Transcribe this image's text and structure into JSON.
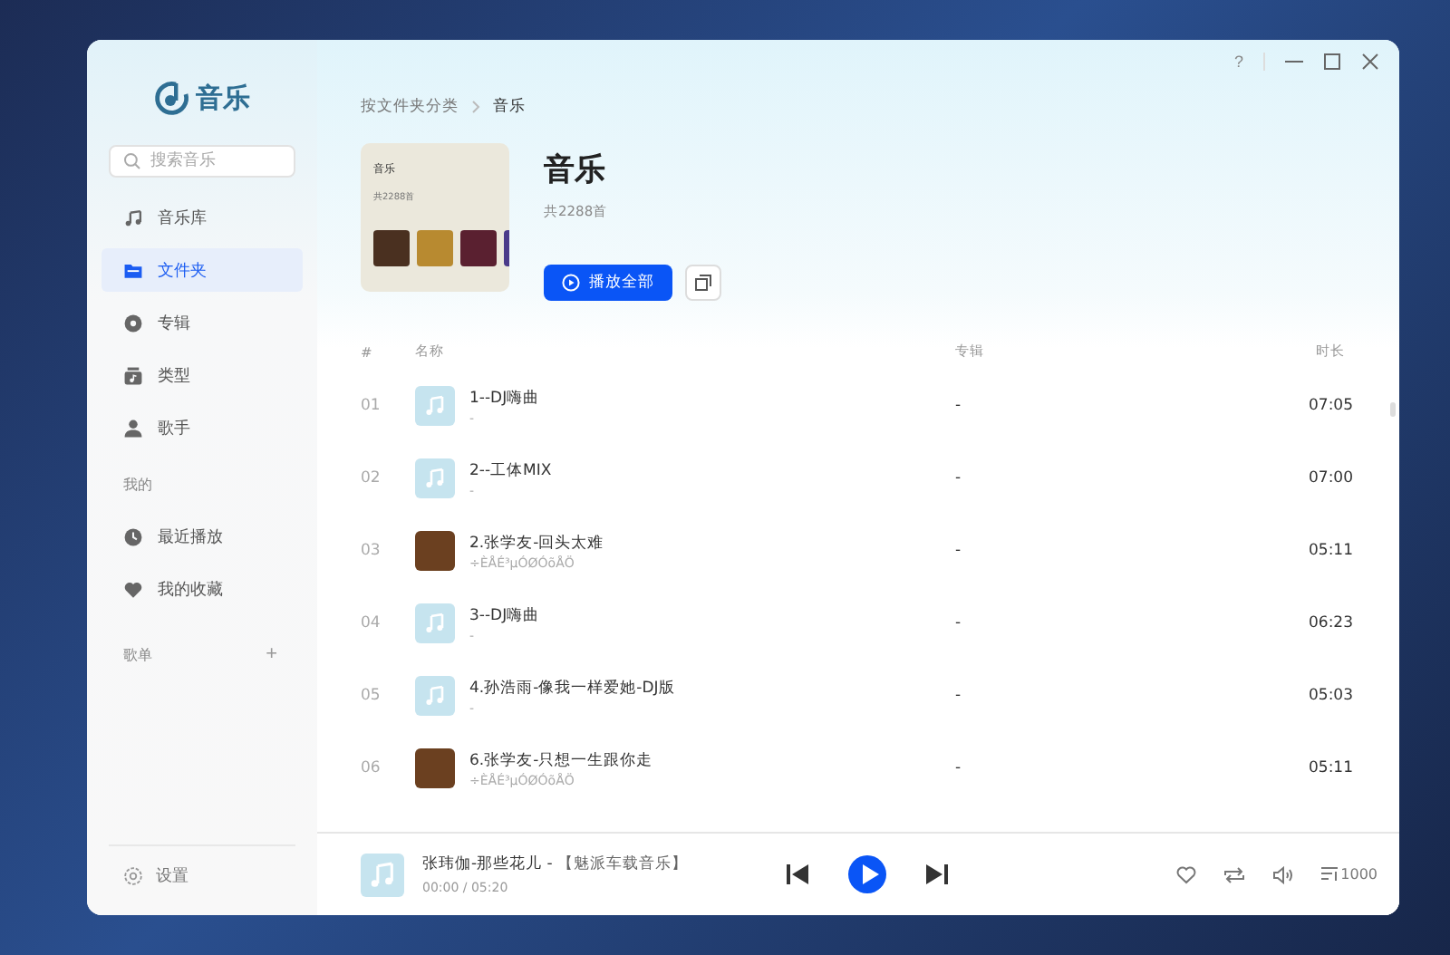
{
  "window": {
    "help": "?"
  },
  "sidebar": {
    "logo": "音乐",
    "search": {
      "placeholder": "搜索音乐"
    },
    "items": [
      {
        "label": "音乐库",
        "kind": "note",
        "selected": false
      },
      {
        "label": "文件夹",
        "kind": "folder",
        "selected": true
      },
      {
        "label": "专辑",
        "kind": "disc",
        "selected": false
      },
      {
        "label": "类型",
        "kind": "genre",
        "selected": false
      },
      {
        "label": "歌手",
        "kind": "artist",
        "selected": false
      }
    ],
    "mine_title": "我的",
    "mine_items": [
      {
        "label": "最近播放",
        "kind": "clock",
        "selected": false
      },
      {
        "label": "我的收藏",
        "kind": "heart",
        "selected": false
      }
    ],
    "playlists_title": "歌单",
    "add": "+",
    "settings": "设置"
  },
  "breadcrumb": [
    "按文件夹分类",
    "音乐"
  ],
  "header": {
    "cover_title": "音乐",
    "cover_count": "共2288首",
    "title": "音乐",
    "count": "共2288首",
    "play_all": "播放全部"
  },
  "table": {
    "columns": [
      "#",
      "名称",
      "专辑",
      "时长"
    ],
    "rows": [
      {
        "index": "01",
        "kind": "note",
        "title": "1--DJ嗨曲",
        "artist": "-",
        "album": "-",
        "duration": "07:05"
      },
      {
        "index": "02",
        "kind": "note",
        "title": "2--工体MIX",
        "artist": "-",
        "album": "-",
        "duration": "07:00"
      },
      {
        "index": "03",
        "kind": "photo",
        "title": "2.张学友-回头太难",
        "artist": "÷ÈÅÉ³µÓØÓõÅÖ",
        "album": "-",
        "duration": "05:11"
      },
      {
        "index": "04",
        "kind": "note",
        "title": "3--DJ嗨曲",
        "artist": "-",
        "album": "-",
        "duration": "06:23"
      },
      {
        "index": "05",
        "kind": "note",
        "title": "4.孙浩雨-像我一样爱她-DJ版",
        "artist": "-",
        "album": "-",
        "duration": "05:03"
      },
      {
        "index": "06",
        "kind": "photo",
        "title": "6.张学友-只想一生跟你走",
        "artist": "÷ÈÅÉ³µÓØÓõÅÖ",
        "album": "-",
        "duration": "05:11"
      }
    ]
  },
  "player": {
    "title": "张玮伽-那些花儿 - ",
    "source": "【魅派车载音乐】",
    "time": "00:00 / 05:20",
    "playlist_count": "1000"
  }
}
